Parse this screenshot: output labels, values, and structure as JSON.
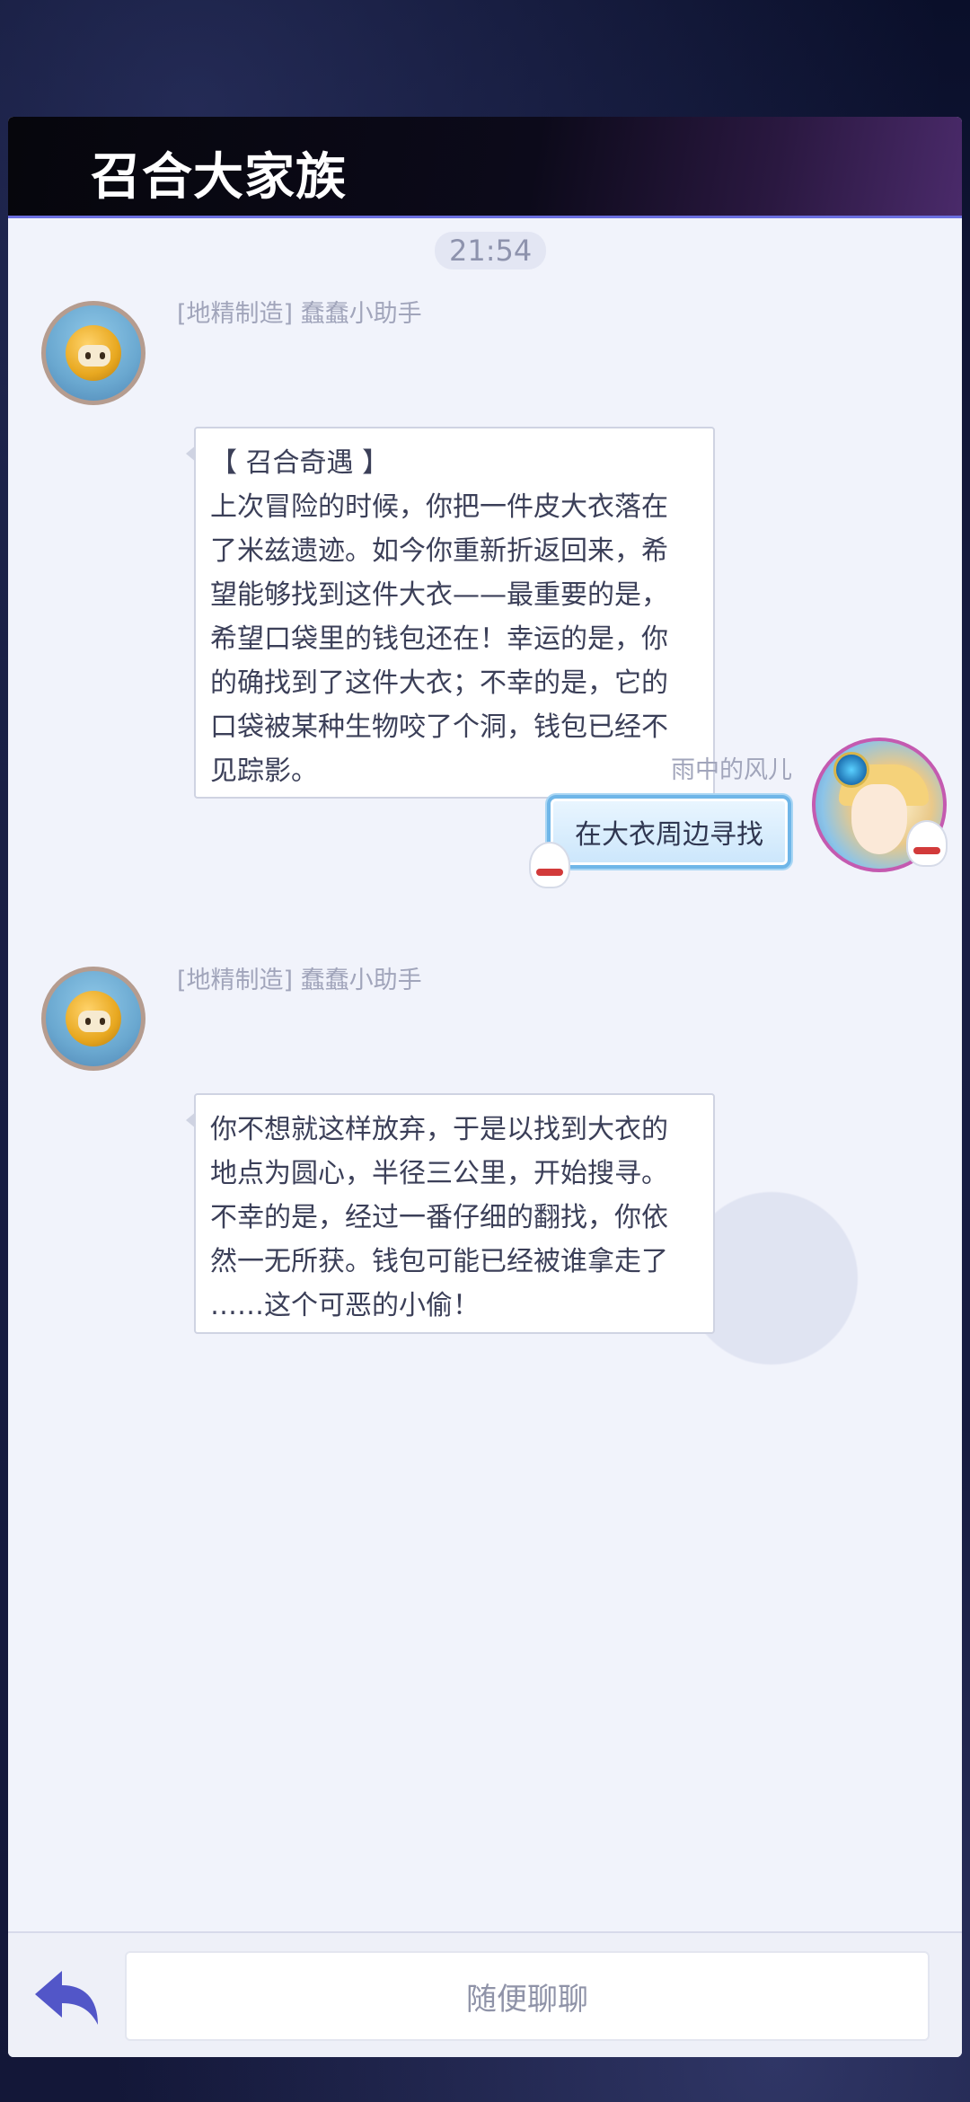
{
  "header": {
    "title": "召合大家族"
  },
  "chat": {
    "timestamp": "21:54",
    "messages": [
      {
        "sender": "[地精制造] 蠢蠢小助手",
        "lines": [
          "【 召合奇遇 】",
          "上次冒险的时候，你把一件皮大衣落在",
          "了米兹遗迹。如今你重新折返回来，希",
          "望能够找到这件大衣——最重要的是，",
          "希望口袋里的钱包还在！幸运的是，你",
          "的确找到了这件大衣；不幸的是，它的",
          "口袋被某种生物咬了个洞，钱包已经不",
          "见踪影。"
        ]
      },
      {
        "sender": "雨中的风儿",
        "text": "在大衣周边寻找"
      },
      {
        "sender": "[地精制造] 蠢蠢小助手",
        "lines": [
          "你不想就这样放弃，于是以找到大衣的",
          "地点为圆心，半径三公里，开始搜寻。",
          "不幸的是，经过一番仔细的翻找，你依",
          "然一无所获。钱包可能已经被谁拿走了",
          "……这个可恶的小偷！"
        ]
      }
    ]
  },
  "footer": {
    "input_placeholder": "随便聊聊",
    "back_icon": "back-arrow-icon"
  },
  "colors": {
    "accent": "#5b5fd6",
    "panel_bg": "#f1f3fb",
    "header_bg": "#06060c"
  }
}
